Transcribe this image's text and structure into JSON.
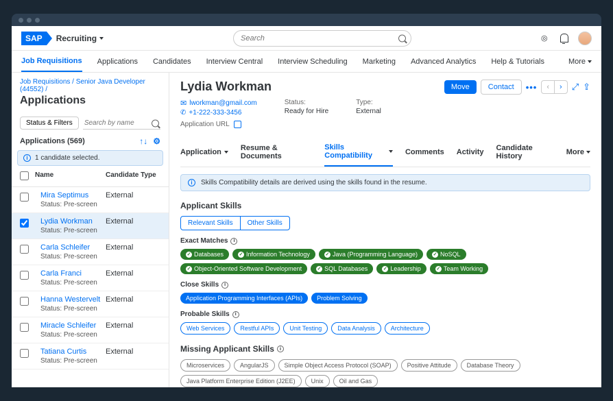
{
  "app_name": "Recruiting",
  "global_search_placeholder": "Search",
  "nav": [
    "Job Requisitions",
    "Applications",
    "Candidates",
    "Interview Central",
    "Interview Scheduling",
    "Marketing",
    "Advanced Analytics",
    "Help & Tutorials"
  ],
  "nav_more": "More",
  "breadcrumb": [
    "Job Requisitions",
    "Senior Java Developer (44552)"
  ],
  "page_title": "Applications",
  "filters_btn": "Status & Filters",
  "name_search_placeholder": "Search by name",
  "applications_count_label": "Applications (569)",
  "selected_text": "1 candidate selected.",
  "list_headers": {
    "name": "Name",
    "type": "Candidate Type"
  },
  "candidates": [
    {
      "name": "Mira Septimus",
      "status": "Pre-screen",
      "type": "External",
      "selected": false
    },
    {
      "name": "Lydia Workman",
      "status": "Pre-screen",
      "type": "External",
      "selected": true
    },
    {
      "name": "Carla Schleifer",
      "status": "Pre-screen",
      "type": "External",
      "selected": false
    },
    {
      "name": "Carla Franci",
      "status": "Pre-screen",
      "type": "External",
      "selected": false
    },
    {
      "name": "Hanna Westervelt",
      "status": "Pre-screen",
      "type": "External",
      "selected": false
    },
    {
      "name": "Miracle Schleifer",
      "status": "Pre-screen",
      "type": "External",
      "selected": false
    },
    {
      "name": "Tatiana Curtis",
      "status": "Pre-screen",
      "type": "External",
      "selected": false
    }
  ],
  "status_label": "Status:",
  "candidate": {
    "name": "Lydia Workman",
    "email": "lworkman@gmail.com",
    "phone": "+1-222-333-3456",
    "status_label": "Status:",
    "status_value": "Ready for Hire",
    "type_label": "Type:",
    "type_value": "External",
    "app_url_label": "Application URL"
  },
  "actions": {
    "move": "Move",
    "contact": "Contact"
  },
  "tabs": [
    "Application",
    "Resume & Documents",
    "Skills Compatibility",
    "Comments",
    "Activity",
    "Candidate History"
  ],
  "tabs_more": "More",
  "info_text": "Skills Compatibility details are derived using the skills found in the resume.",
  "applicant_skills_title": "Applicant Skills",
  "skill_tabs": [
    "Relevant Skills",
    "Other Skills"
  ],
  "exact_title": "Exact Matches",
  "exact": [
    "Databases",
    "Information Technology",
    "Java (Programming Language)",
    "NoSQL",
    "Object-Oriented Software Development",
    "SQL Databases",
    "Leadership",
    "Team Working"
  ],
  "close_title": "Close Skills",
  "close": [
    "Application Programming Interfaces (APIs)",
    "Problem Solving"
  ],
  "probable_title": "Probable Skills",
  "probable": [
    "Web Services",
    "Restful APIs",
    "Unit Testing",
    "Data Analysis",
    "Architecture"
  ],
  "missing_title": "Missing Applicant Skills",
  "missing": [
    "Microservices",
    "AngularJS",
    "Simple Object Access Protocol (SOAP)",
    "Positive Attitude",
    "Database Theory",
    "Java Platform Enterprise Edition (J2EE)",
    "Unix",
    "Oil and Gas"
  ]
}
